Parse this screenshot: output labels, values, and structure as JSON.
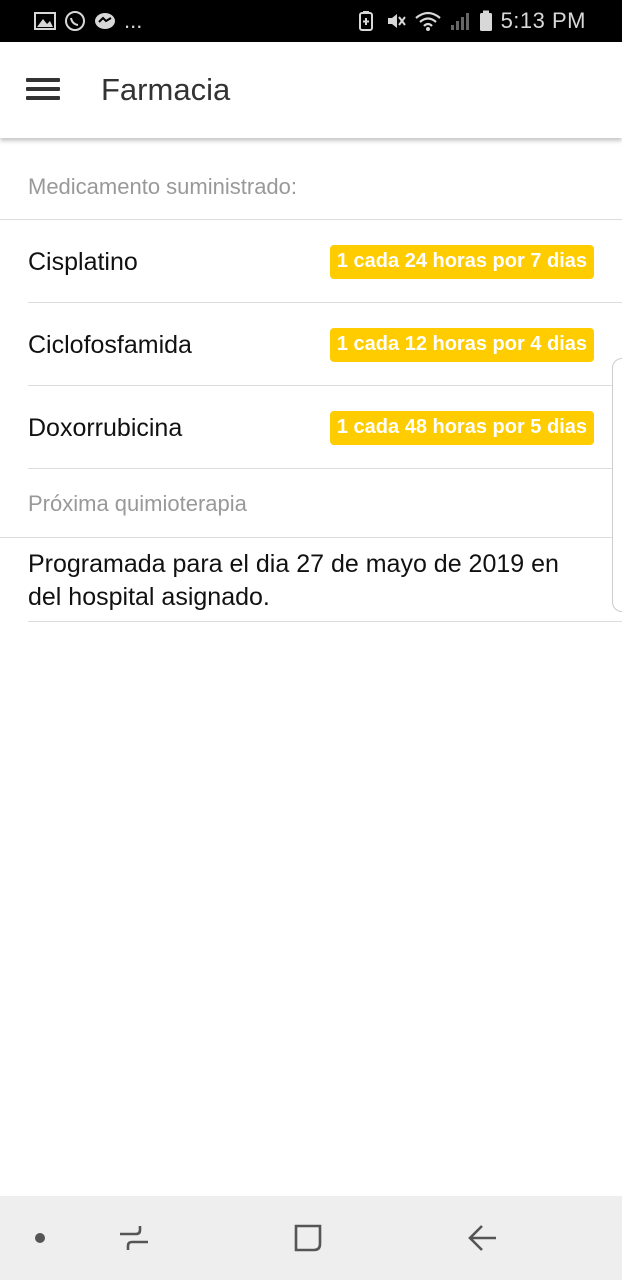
{
  "status_bar": {
    "time": "5:13 PM",
    "more_indicator": "...",
    "left_icons": [
      "gallery-icon",
      "whatsapp-icon",
      "messenger-icon"
    ],
    "right_icons": [
      "battery-saver-icon",
      "vibrate-mute-icon",
      "wifi-icon",
      "signal-icon",
      "battery-icon"
    ]
  },
  "app_bar": {
    "title": "Farmacia",
    "menu_icon": "hamburger-menu-icon"
  },
  "medications": {
    "header": "Medicamento suministrado:",
    "items": [
      {
        "name": "Cisplatino",
        "dose": "1 cada 24 horas por 7 dias"
      },
      {
        "name": "Ciclofosfamida",
        "dose": "1 cada 12 horas por 4 dias"
      },
      {
        "name": "Doxorrubicina",
        "dose": "1 cada 48 horas por 5 dias"
      }
    ]
  },
  "next_chemo": {
    "header": "Próxima quimioterapia",
    "line1": "Programada para el dia 27 de mayo de 2019 en",
    "line2": "del hospital asignado."
  },
  "nav_bar": {
    "icons": [
      "dot-icon",
      "recent-apps-icon",
      "home-icon",
      "back-icon"
    ]
  },
  "colors": {
    "badge_background": "#ffcc00",
    "badge_text": "#ffffff",
    "status_bar": "#000000",
    "nav_bar": "#eeeeee"
  }
}
